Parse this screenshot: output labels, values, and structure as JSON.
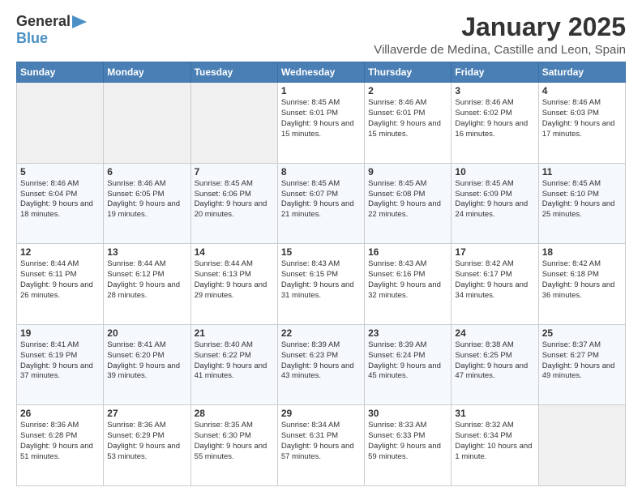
{
  "logo": {
    "line1": "General",
    "arrow": "▶",
    "line2": "Blue"
  },
  "title": "January 2025",
  "location": "Villaverde de Medina, Castille and Leon, Spain",
  "days_header": [
    "Sunday",
    "Monday",
    "Tuesday",
    "Wednesday",
    "Thursday",
    "Friday",
    "Saturday"
  ],
  "weeks": [
    [
      {
        "day": "",
        "info": ""
      },
      {
        "day": "",
        "info": ""
      },
      {
        "day": "",
        "info": ""
      },
      {
        "day": "1",
        "info": "Sunrise: 8:45 AM\nSunset: 6:01 PM\nDaylight: 9 hours\nand 15 minutes."
      },
      {
        "day": "2",
        "info": "Sunrise: 8:46 AM\nSunset: 6:01 PM\nDaylight: 9 hours\nand 15 minutes."
      },
      {
        "day": "3",
        "info": "Sunrise: 8:46 AM\nSunset: 6:02 PM\nDaylight: 9 hours\nand 16 minutes."
      },
      {
        "day": "4",
        "info": "Sunrise: 8:46 AM\nSunset: 6:03 PM\nDaylight: 9 hours\nand 17 minutes."
      }
    ],
    [
      {
        "day": "5",
        "info": "Sunrise: 8:46 AM\nSunset: 6:04 PM\nDaylight: 9 hours\nand 18 minutes."
      },
      {
        "day": "6",
        "info": "Sunrise: 8:46 AM\nSunset: 6:05 PM\nDaylight: 9 hours\nand 19 minutes."
      },
      {
        "day": "7",
        "info": "Sunrise: 8:45 AM\nSunset: 6:06 PM\nDaylight: 9 hours\nand 20 minutes."
      },
      {
        "day": "8",
        "info": "Sunrise: 8:45 AM\nSunset: 6:07 PM\nDaylight: 9 hours\nand 21 minutes."
      },
      {
        "day": "9",
        "info": "Sunrise: 8:45 AM\nSunset: 6:08 PM\nDaylight: 9 hours\nand 22 minutes."
      },
      {
        "day": "10",
        "info": "Sunrise: 8:45 AM\nSunset: 6:09 PM\nDaylight: 9 hours\nand 24 minutes."
      },
      {
        "day": "11",
        "info": "Sunrise: 8:45 AM\nSunset: 6:10 PM\nDaylight: 9 hours\nand 25 minutes."
      }
    ],
    [
      {
        "day": "12",
        "info": "Sunrise: 8:44 AM\nSunset: 6:11 PM\nDaylight: 9 hours\nand 26 minutes."
      },
      {
        "day": "13",
        "info": "Sunrise: 8:44 AM\nSunset: 6:12 PM\nDaylight: 9 hours\nand 28 minutes."
      },
      {
        "day": "14",
        "info": "Sunrise: 8:44 AM\nSunset: 6:13 PM\nDaylight: 9 hours\nand 29 minutes."
      },
      {
        "day": "15",
        "info": "Sunrise: 8:43 AM\nSunset: 6:15 PM\nDaylight: 9 hours\nand 31 minutes."
      },
      {
        "day": "16",
        "info": "Sunrise: 8:43 AM\nSunset: 6:16 PM\nDaylight: 9 hours\nand 32 minutes."
      },
      {
        "day": "17",
        "info": "Sunrise: 8:42 AM\nSunset: 6:17 PM\nDaylight: 9 hours\nand 34 minutes."
      },
      {
        "day": "18",
        "info": "Sunrise: 8:42 AM\nSunset: 6:18 PM\nDaylight: 9 hours\nand 36 minutes."
      }
    ],
    [
      {
        "day": "19",
        "info": "Sunrise: 8:41 AM\nSunset: 6:19 PM\nDaylight: 9 hours\nand 37 minutes."
      },
      {
        "day": "20",
        "info": "Sunrise: 8:41 AM\nSunset: 6:20 PM\nDaylight: 9 hours\nand 39 minutes."
      },
      {
        "day": "21",
        "info": "Sunrise: 8:40 AM\nSunset: 6:22 PM\nDaylight: 9 hours\nand 41 minutes."
      },
      {
        "day": "22",
        "info": "Sunrise: 8:39 AM\nSunset: 6:23 PM\nDaylight: 9 hours\nand 43 minutes."
      },
      {
        "day": "23",
        "info": "Sunrise: 8:39 AM\nSunset: 6:24 PM\nDaylight: 9 hours\nand 45 minutes."
      },
      {
        "day": "24",
        "info": "Sunrise: 8:38 AM\nSunset: 6:25 PM\nDaylight: 9 hours\nand 47 minutes."
      },
      {
        "day": "25",
        "info": "Sunrise: 8:37 AM\nSunset: 6:27 PM\nDaylight: 9 hours\nand 49 minutes."
      }
    ],
    [
      {
        "day": "26",
        "info": "Sunrise: 8:36 AM\nSunset: 6:28 PM\nDaylight: 9 hours\nand 51 minutes."
      },
      {
        "day": "27",
        "info": "Sunrise: 8:36 AM\nSunset: 6:29 PM\nDaylight: 9 hours\nand 53 minutes."
      },
      {
        "day": "28",
        "info": "Sunrise: 8:35 AM\nSunset: 6:30 PM\nDaylight: 9 hours\nand 55 minutes."
      },
      {
        "day": "29",
        "info": "Sunrise: 8:34 AM\nSunset: 6:31 PM\nDaylight: 9 hours\nand 57 minutes."
      },
      {
        "day": "30",
        "info": "Sunrise: 8:33 AM\nSunset: 6:33 PM\nDaylight: 9 hours\nand 59 minutes."
      },
      {
        "day": "31",
        "info": "Sunrise: 8:32 AM\nSunset: 6:34 PM\nDaylight: 10 hours\nand 1 minute."
      },
      {
        "day": "",
        "info": ""
      }
    ]
  ]
}
